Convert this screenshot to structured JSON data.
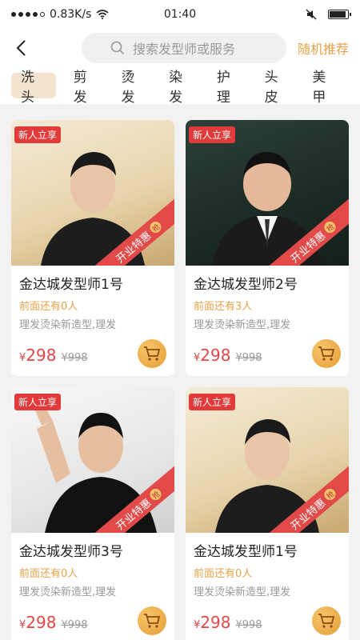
{
  "status_bar": {
    "network_speed": "0.83K/s",
    "time": "01:40",
    "battery_level": 0.9
  },
  "header": {
    "search_placeholder": "搜索发型师或服务",
    "random_label": "随机推荐"
  },
  "tabs": [
    {
      "label": "洗头",
      "active": true
    },
    {
      "label": "剪发",
      "active": false
    },
    {
      "label": "烫发",
      "active": false
    },
    {
      "label": "染发",
      "active": false
    },
    {
      "label": "护理",
      "active": false
    },
    {
      "label": "头皮",
      "active": false
    },
    {
      "label": "美甲",
      "active": false
    }
  ],
  "cards": [
    {
      "badge": "新人立享",
      "ribbon": "开业特惠",
      "seal": "抢",
      "name": "金达城发型师1号",
      "queue": "前面还有0人",
      "tags": "理发烫染新造型,理发",
      "currency": "¥",
      "price": "298",
      "original_price": "¥998",
      "photo_style": "light"
    },
    {
      "badge": "新人立享",
      "ribbon": "开业特惠",
      "seal": "抢",
      "name": "金达城发型师2号",
      "queue": "前面还有3人",
      "tags": "理发烫染新造型,理发",
      "currency": "¥",
      "price": "298",
      "original_price": "¥998",
      "photo_style": "dark"
    },
    {
      "badge": "新人立享",
      "ribbon": "开业特惠",
      "seal": "抢",
      "name": "金达城发型师3号",
      "queue": "前面还有0人",
      "tags": "理发烫染新造型,理发",
      "currency": "¥",
      "price": "298",
      "original_price": "¥998",
      "photo_style": "white"
    },
    {
      "badge": "新人立享",
      "ribbon": "开业特惠",
      "seal": "抢",
      "name": "金达城发型师1号",
      "queue": "前面还有0人",
      "tags": "理发烫染新造型,理发",
      "currency": "¥",
      "price": "298",
      "original_price": "¥998",
      "photo_style": "light"
    }
  ],
  "colors": {
    "accent": "#e8a34a",
    "price": "#e04848",
    "badge": "#e03a3a",
    "active_tab_bg": "#f4e4cf"
  }
}
